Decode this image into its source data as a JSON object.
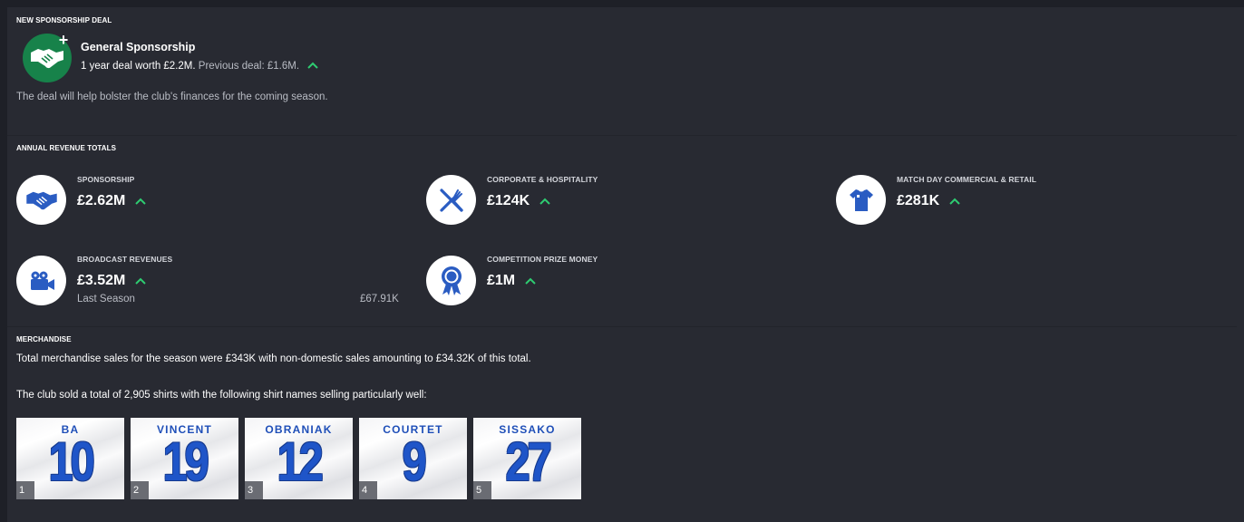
{
  "colors": {
    "accent_green": "#2ecc71",
    "icon_blue": "#2a5cc2",
    "deal_green": "#17824a"
  },
  "new_deal": {
    "section_title": "NEW SPONSORSHIP DEAL",
    "icon": "handshake-plus-icon",
    "name": "General Sponsorship",
    "deal_text": "1 year deal worth £2.2M.",
    "previous_text": "Previous deal: £1.6M.",
    "trend": "up",
    "description": "The deal will help bolster the club's finances for the coming season."
  },
  "revenue": {
    "section_title": "ANNUAL REVENUE TOTALS",
    "sponsorship": {
      "label": "SPONSORSHIP",
      "value": "£2.62M",
      "trend": "up",
      "icon": "handshake-icon"
    },
    "corporate": {
      "label": "CORPORATE & HOSPITALITY",
      "value": "£124K",
      "trend": "up",
      "icon": "cutlery-icon"
    },
    "matchday": {
      "label": "MATCH DAY COMMERCIAL & RETAIL",
      "value": "£281K",
      "trend": "up",
      "icon": "shirt-icon"
    },
    "broadcast": {
      "label": "BROADCAST REVENUES",
      "value": "£3.52M",
      "trend": "up",
      "icon": "camera-icon",
      "sub_label": "Last Season",
      "sub_value": "£67.91K"
    },
    "prize": {
      "label": "COMPETITION PRIZE MONEY",
      "value": "£1M",
      "trend": "up",
      "icon": "rosette-icon"
    }
  },
  "merchandise": {
    "section_title": "MERCHANDISE",
    "sales_text": "Total merchandise sales for the season were £343K with non-domestic sales amounting to £34.32K of this total.",
    "shirts_text": "The club sold a total of 2,905 shirts with the following shirt names selling particularly well:",
    "shirts": [
      {
        "rank": "1",
        "name": "BA",
        "number": "10"
      },
      {
        "rank": "2",
        "name": "VINCENT",
        "number": "19"
      },
      {
        "rank": "3",
        "name": "OBRANIAK",
        "number": "12"
      },
      {
        "rank": "4",
        "name": "COURTET",
        "number": "9"
      },
      {
        "rank": "5",
        "name": "SISSAKO",
        "number": "27"
      }
    ]
  }
}
